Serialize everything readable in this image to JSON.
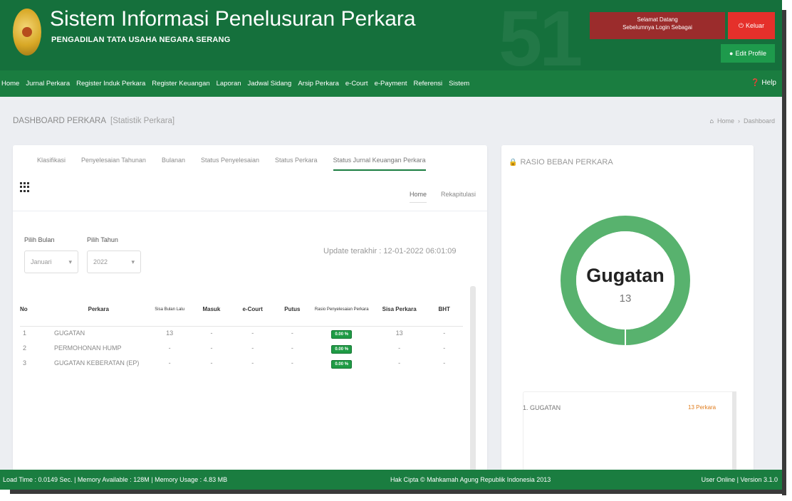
{
  "header": {
    "title": "Sistem Informasi Penelusuran Perkara",
    "subtitle": "PENGADILAN TATA USAHA NEGARA SERANG",
    "session_text": "Sebelumnya Login Sebagai",
    "session_prefix": "Selamat Datang",
    "logout_label": "Keluar",
    "edit_profile_label": "Edit Profile"
  },
  "nav": {
    "items": [
      "Home",
      "Jurnal Perkara",
      "Register Induk Perkara",
      "Register Keuangan",
      "Laporan",
      "Jadwal Sidang",
      "Arsip Perkara",
      "e-Court",
      "e-Payment",
      "Referensi",
      "Sistem"
    ],
    "help_label": "Help"
  },
  "page": {
    "title": "DASHBOARD PERKARA",
    "title_small": "[Statistik Perkara]",
    "breadcrumb_home": "Home",
    "breadcrumb_current": "Dashboard"
  },
  "main_card": {
    "tabs": [
      "Klasifikasi",
      "Penyelesaian Tahunan",
      "Bulanan",
      "Status Penyelesaian",
      "Status Perkara",
      "Status Jurnal Keuangan Perkara"
    ],
    "subtabs": [
      "Home",
      "Rekapitulasi"
    ],
    "filter_month_label": "Pilih Bulan",
    "filter_month_value": "Januari",
    "filter_year_label": "Pilih Tahun",
    "filter_year_value": "2022",
    "update_text": "Update terakhir : 12-01-2022 06:01:09",
    "columns": [
      "No",
      "Perkara",
      "Sisa Bulan Lalu",
      "Masuk",
      "e-Court",
      "Putus",
      "Rasio Penyelesaian Perkara",
      "Sisa Perkara",
      "BHT"
    ],
    "rows": [
      {
        "no": "1",
        "perkara": "GUGATAN",
        "sisa_lalu": "13",
        "masuk": "-",
        "ecourt": "-",
        "putus": "-",
        "rasio": "0.00 %",
        "sisa": "13",
        "bht": "-"
      },
      {
        "no": "2",
        "perkara": "PERMOHONAN HUMP",
        "sisa_lalu": "-",
        "masuk": "-",
        "ecourt": "-",
        "putus": "-",
        "rasio": "0.00 %",
        "sisa": "-",
        "bht": "-"
      },
      {
        "no": "3",
        "perkara": "GUGATAN KEBERATAN (EP)",
        "sisa_lalu": "-",
        "masuk": "-",
        "ecourt": "-",
        "putus": "-",
        "rasio": "0.00 %",
        "sisa": "-",
        "bht": "-"
      }
    ]
  },
  "ratio_card": {
    "title": "RASIO BEBAN PERKARA",
    "center_label": "Gugatan",
    "center_value": "13",
    "legend_label": "1. GUGATAN",
    "legend_value": "13 Perkara",
    "ring_color": "#58b26e"
  },
  "footer": {
    "left": "Load Time : 0.0149 Sec. | Memory Available : 128M | Memory Usage : 4.83 MB",
    "center": "Hak Cipta © Mahkamah Agung Republik Indonesia 2013",
    "right": "User Online | Version 3.1.0"
  }
}
